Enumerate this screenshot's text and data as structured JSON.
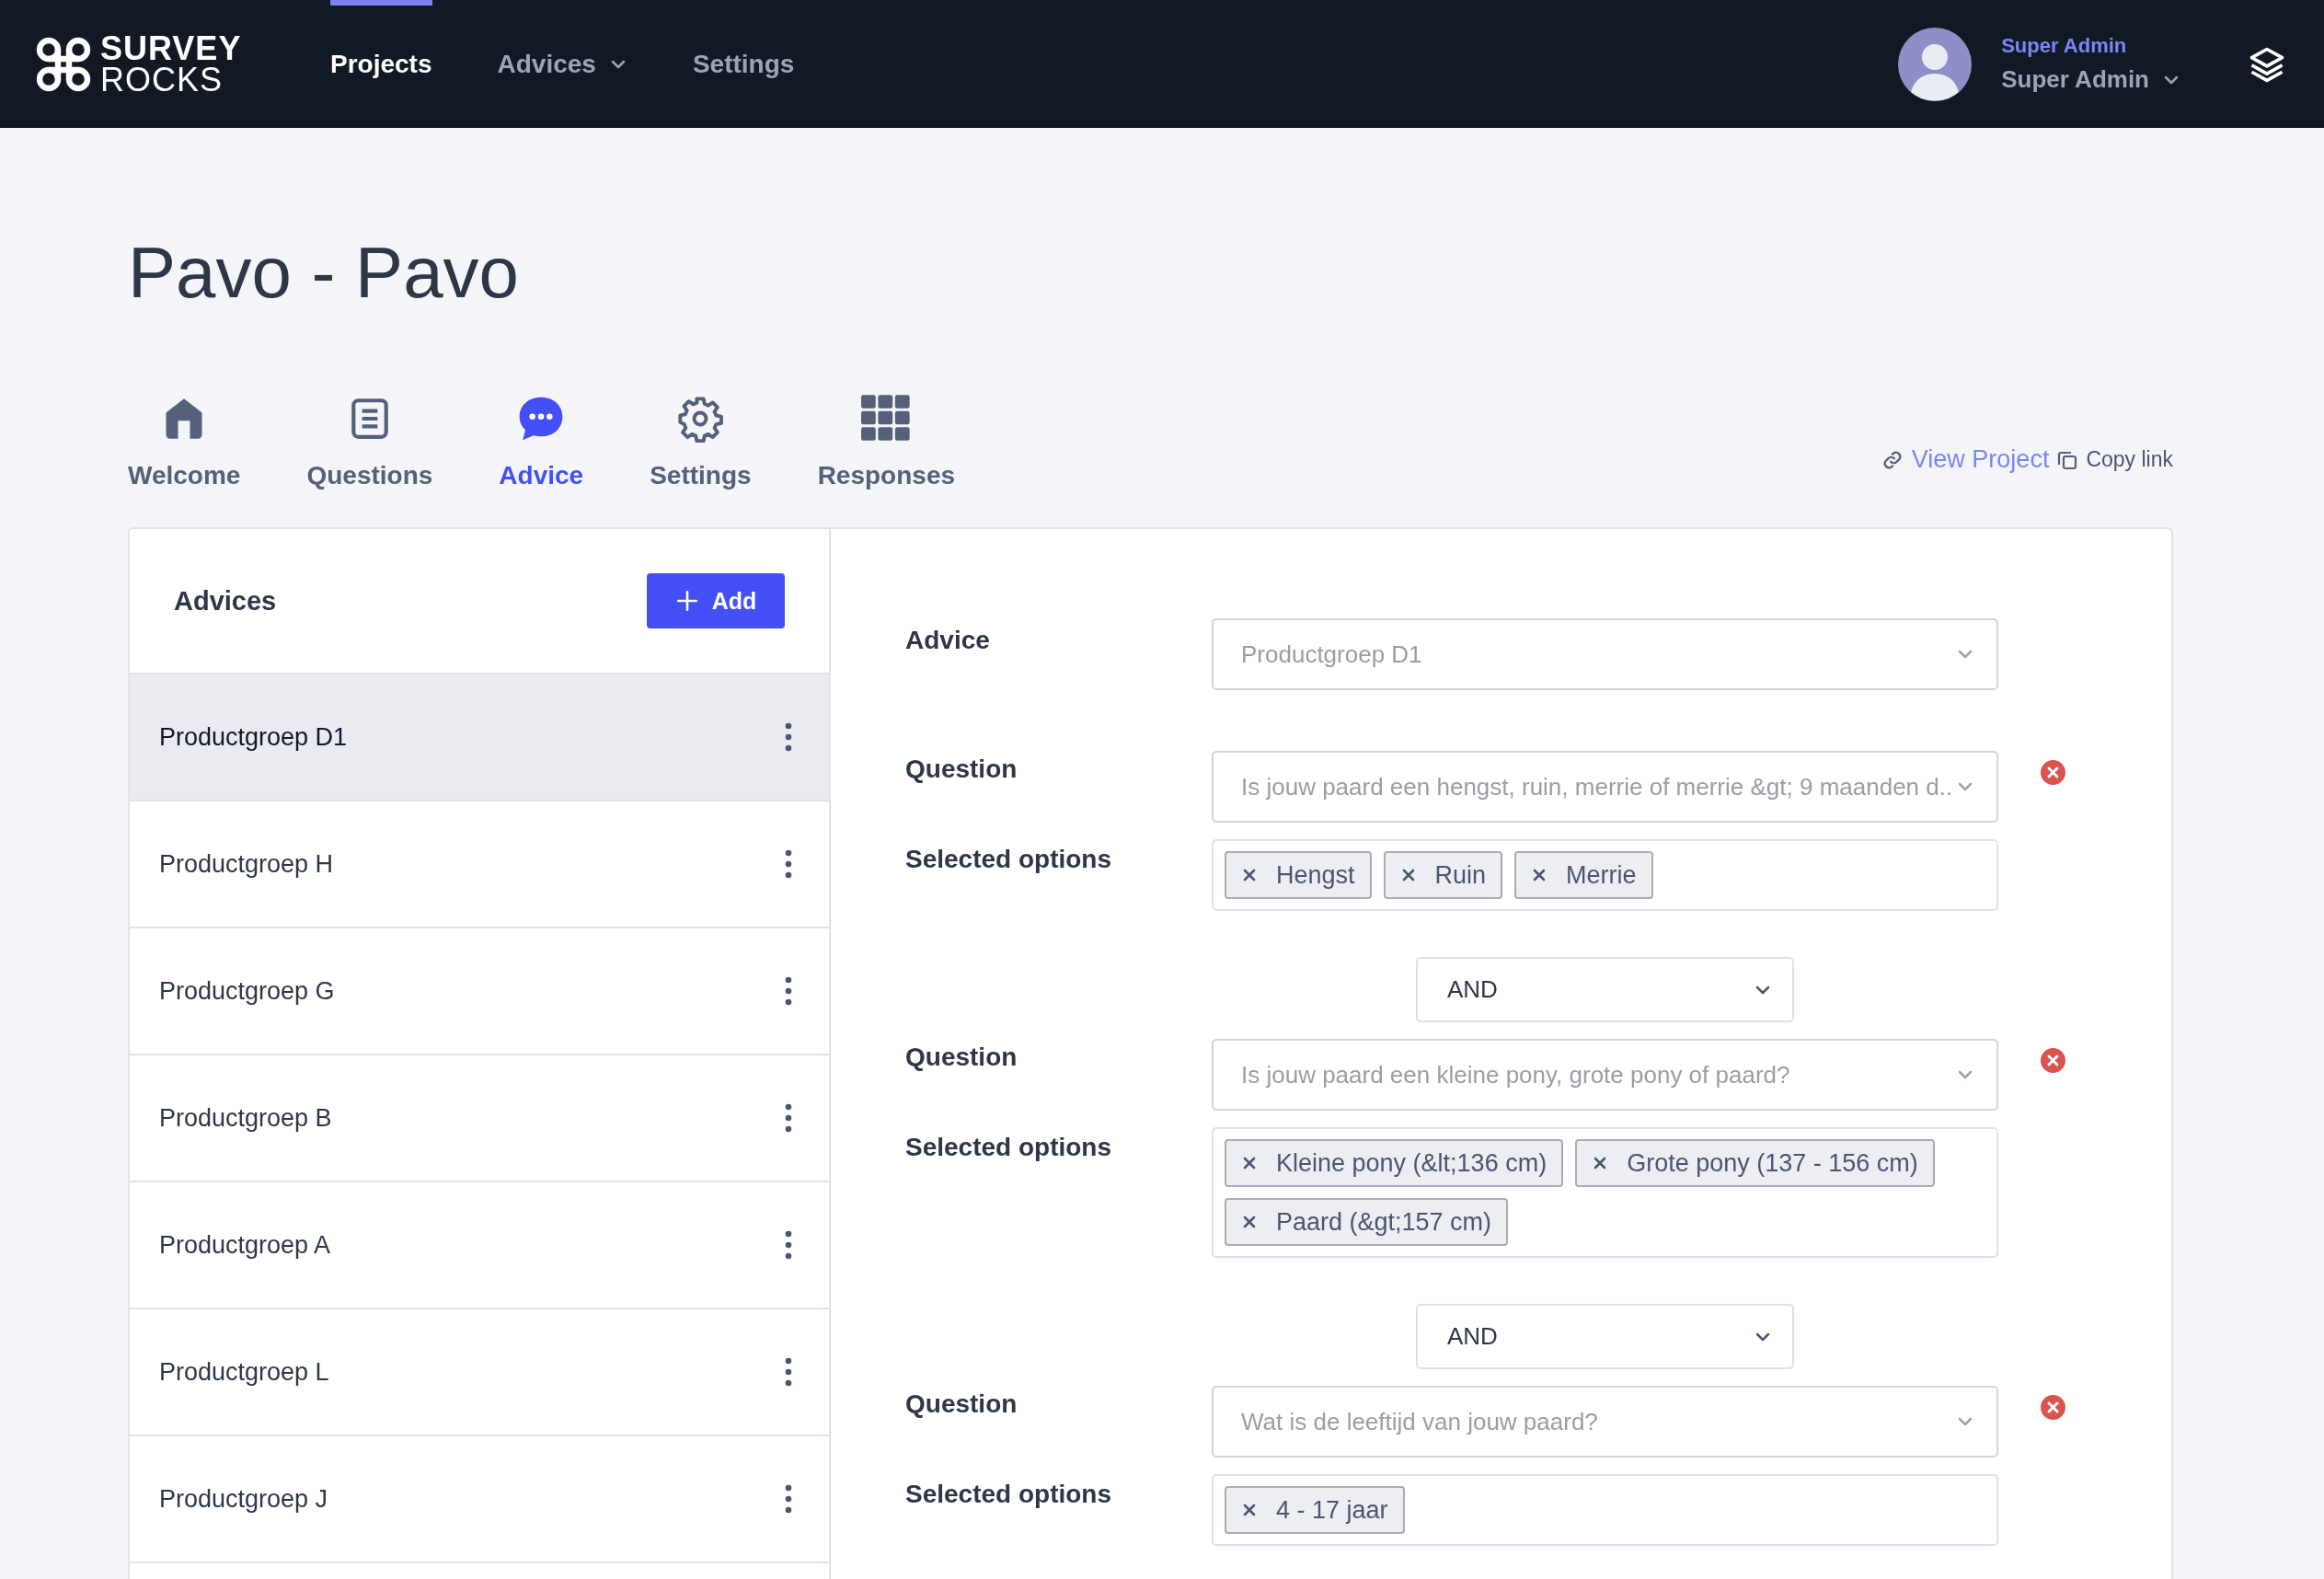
{
  "header": {
    "logo": {
      "line1": "SURVEY",
      "line2": "ROCKS"
    },
    "nav": [
      {
        "label": "Projects",
        "selected": true,
        "has_menu": false
      },
      {
        "label": "Advices",
        "selected": false,
        "has_menu": true
      },
      {
        "label": "Settings",
        "selected": false,
        "has_menu": false
      }
    ],
    "user": {
      "role": "Super Admin",
      "name": "Super Admin"
    }
  },
  "page": {
    "title": "Pavo - Pavo"
  },
  "tabs": [
    {
      "label": "Welcome",
      "selected": false
    },
    {
      "label": "Questions",
      "selected": false
    },
    {
      "label": "Advice",
      "selected": true
    },
    {
      "label": "Settings",
      "selected": false
    },
    {
      "label": "Responses",
      "selected": false
    }
  ],
  "links": {
    "view_project": "View Project",
    "copy_link": "Copy link"
  },
  "advices": {
    "title": "Advices",
    "add_button": "Add",
    "items": [
      {
        "label": "Productgroep D1",
        "selected": true
      },
      {
        "label": "Productgroep H",
        "selected": false
      },
      {
        "label": "Productgroep G",
        "selected": false
      },
      {
        "label": "Productgroep B",
        "selected": false
      },
      {
        "label": "Productgroep A",
        "selected": false
      },
      {
        "label": "Productgroep L",
        "selected": false
      },
      {
        "label": "Productgroep J",
        "selected": false
      }
    ]
  },
  "form": {
    "advice": {
      "label": "Advice",
      "value": "Productgroep D1"
    },
    "conditions": [
      {
        "question_label": "Question",
        "question": "Is jouw paard een hengst, ruin, merrie of merrie &gt; 9 maanden d..",
        "options_label": "Selected options",
        "options": [
          "Hengst",
          "Ruin",
          "Merrie"
        ]
      },
      {
        "operator": "AND",
        "question_label": "Question",
        "question": "Is jouw paard een kleine pony, grote pony of paard?",
        "options_label": "Selected options",
        "options": [
          "Kleine pony (&lt;136 cm)",
          "Grote pony (137 - 156 cm)",
          "Paard (&gt;157 cm)"
        ]
      },
      {
        "operator": "AND",
        "question_label": "Question",
        "question": "Wat is de leeftijd van jouw paard?",
        "options_label": "Selected options",
        "options": [
          "4 - 17 jaar"
        ]
      }
    ]
  }
}
